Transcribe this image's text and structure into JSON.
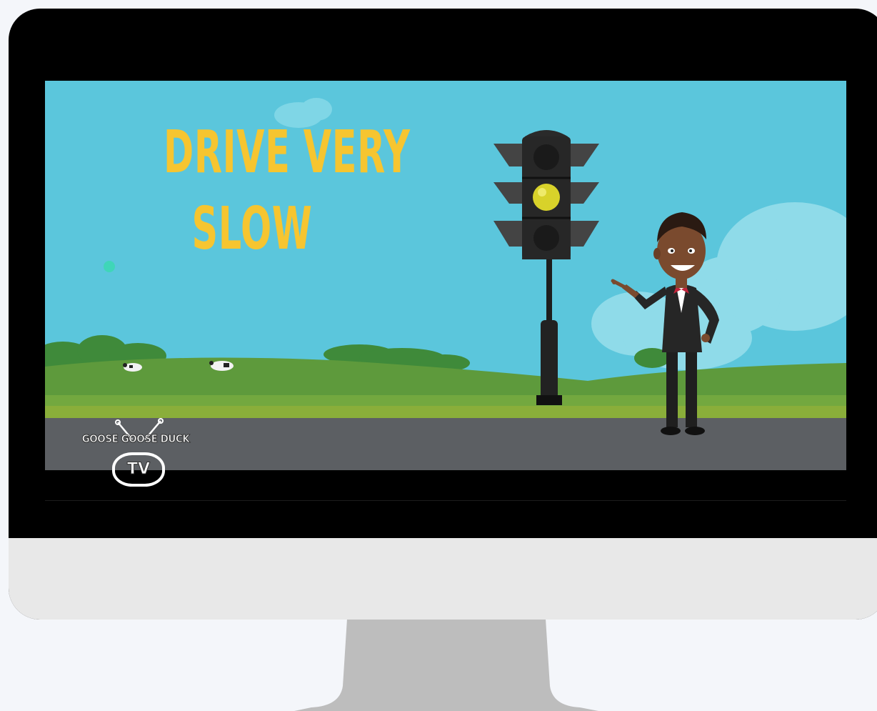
{
  "video": {
    "headline_line1": "DRIVE VERY",
    "headline_line2": "SLOW",
    "logo_text": "GOOSE GOOSE DUCK",
    "logo_tv": "TV",
    "traffic_light_active": "yellow"
  },
  "colors": {
    "sky": "#5bc6dc",
    "headline": "#f6c530",
    "grass": "#5e9a3c",
    "road": "#5c5f63",
    "light_on": "#d8d22a",
    "monitor_bezel": "#000000",
    "monitor_chin": "#e8e8e8",
    "stand": "#bdbdbd"
  }
}
